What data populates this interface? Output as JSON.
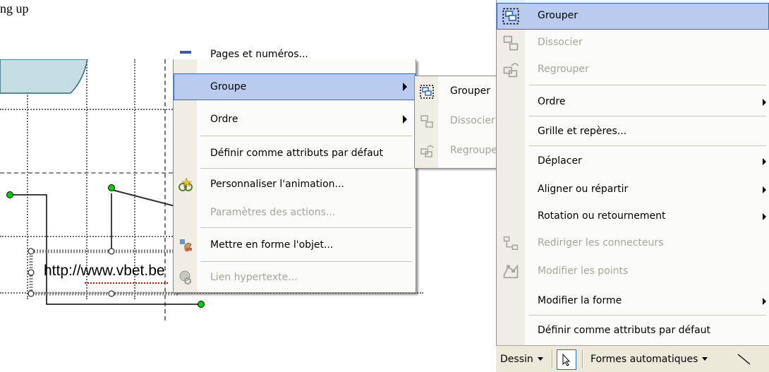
{
  "page": {
    "top_left_text": "ng up"
  },
  "slide": {
    "link_text": "http://www.vbet.be"
  },
  "context_menu": {
    "items": [
      {
        "label": "Pages et numéros...",
        "disabled": false
      },
      {
        "label": "Groupe",
        "highlighted": true,
        "submenu": true
      },
      {
        "label": "Ordre",
        "submenu": true
      },
      {
        "label": "Définir comme attributs par défaut"
      },
      {
        "label": "Personnaliser l'animation...",
        "icon": "custom-animation-icon"
      },
      {
        "label": "Paramètres des actions...",
        "disabled": true
      },
      {
        "label": "Mettre en forme l'objet...",
        "icon": "format-object-icon"
      },
      {
        "label": "Lien hypertexte...",
        "disabled": true,
        "icon": "hyperlink-icon"
      }
    ]
  },
  "group_submenu": {
    "items": [
      {
        "label": "Grouper",
        "icon": "group-icon"
      },
      {
        "label": "Dissocier",
        "disabled": true,
        "icon": "ungroup-icon"
      },
      {
        "label": "Regrouper",
        "disabled": true,
        "icon": "regroup-icon"
      }
    ]
  },
  "draw_menu": {
    "items": [
      {
        "label": "Grouper",
        "highlighted": true,
        "icon": "group-icon"
      },
      {
        "label": "Dissocier",
        "disabled": true,
        "icon": "ungroup-icon"
      },
      {
        "label": "Regrouper",
        "disabled": true,
        "icon": "regroup-icon"
      },
      {
        "label": "Ordre",
        "submenu": true
      },
      {
        "label": "Grille et repères..."
      },
      {
        "label": "Déplacer",
        "submenu": true
      },
      {
        "label": "Aligner ou répartir",
        "submenu": true
      },
      {
        "label": "Rotation ou retournement",
        "submenu": true
      },
      {
        "label": "Rediriger les connecteurs",
        "disabled": true,
        "icon": "reroute-connectors-icon"
      },
      {
        "label": "Modifier les points",
        "disabled": true,
        "icon": "edit-points-icon"
      },
      {
        "label": "Modifier la forme",
        "submenu": true
      },
      {
        "label": "Définir comme attributs par défaut"
      }
    ]
  },
  "toolbar": {
    "draw_label": "Dessin",
    "autoshapes_label": "Formes automatiques"
  },
  "colors": {
    "highlight": "#b9cbef",
    "highlight_border": "#316ac5",
    "shape_fill": "#c5dde3",
    "handle": "#00cc00"
  }
}
